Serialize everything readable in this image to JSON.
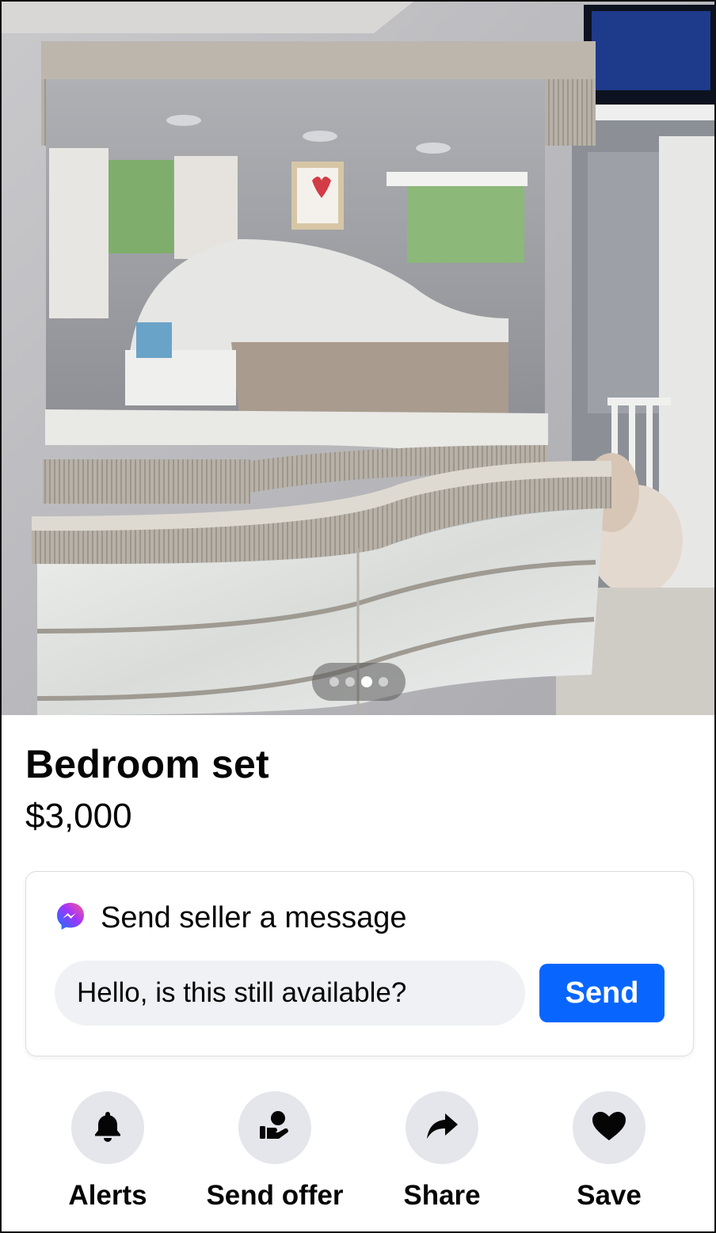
{
  "listing": {
    "title": "Bedroom set",
    "price": "$3,000"
  },
  "gallery": {
    "photo_count": 4,
    "active_index": 2
  },
  "message": {
    "heading": "Send seller a message",
    "input_value": "Hello, is this still available?",
    "send_label": "Send",
    "icon": "messenger-icon"
  },
  "actions": [
    {
      "label": "Alerts",
      "icon": "bell-icon"
    },
    {
      "label": "Send offer",
      "icon": "offer-hand-icon"
    },
    {
      "label": "Share",
      "icon": "share-arrow-icon"
    },
    {
      "label": "Save",
      "icon": "heart-icon"
    }
  ],
  "colors": {
    "accent": "#0866ff",
    "icon_bg": "#e4e6eb",
    "input_bg": "#eff1f4"
  }
}
